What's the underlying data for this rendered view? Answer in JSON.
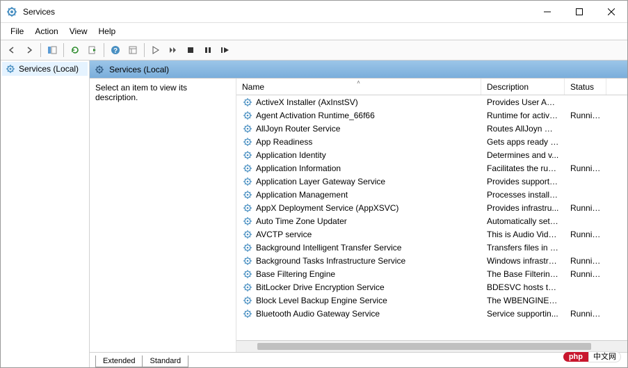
{
  "window": {
    "title": "Services"
  },
  "menubar": [
    "File",
    "Action",
    "View",
    "Help"
  ],
  "tree": {
    "root": "Services (Local)"
  },
  "pane_header": "Services (Local)",
  "desc_prompt": "Select an item to view its description.",
  "columns": {
    "name": "Name",
    "description": "Description",
    "status": "Status"
  },
  "services": [
    {
      "name": "ActiveX Installer (AxInstSV)",
      "desc": "Provides User Acc...",
      "status": ""
    },
    {
      "name": "Agent Activation Runtime_66f66",
      "desc": "Runtime for activa...",
      "status": "Running"
    },
    {
      "name": "AllJoyn Router Service",
      "desc": "Routes AllJoyn me...",
      "status": ""
    },
    {
      "name": "App Readiness",
      "desc": "Gets apps ready fo...",
      "status": ""
    },
    {
      "name": "Application Identity",
      "desc": "Determines and v...",
      "status": ""
    },
    {
      "name": "Application Information",
      "desc": "Facilitates the run...",
      "status": "Running"
    },
    {
      "name": "Application Layer Gateway Service",
      "desc": "Provides support f...",
      "status": ""
    },
    {
      "name": "Application Management",
      "desc": "Processes installat...",
      "status": ""
    },
    {
      "name": "AppX Deployment Service (AppXSVC)",
      "desc": "Provides infrastru...",
      "status": "Running"
    },
    {
      "name": "Auto Time Zone Updater",
      "desc": "Automatically sets...",
      "status": ""
    },
    {
      "name": "AVCTP service",
      "desc": "This is Audio Vide...",
      "status": "Running"
    },
    {
      "name": "Background Intelligent Transfer Service",
      "desc": "Transfers files in th...",
      "status": ""
    },
    {
      "name": "Background Tasks Infrastructure Service",
      "desc": "Windows infrastru...",
      "status": "Running"
    },
    {
      "name": "Base Filtering Engine",
      "desc": "The Base Filtering ...",
      "status": "Running"
    },
    {
      "name": "BitLocker Drive Encryption Service",
      "desc": "BDESVC hosts the ...",
      "status": ""
    },
    {
      "name": "Block Level Backup Engine Service",
      "desc": "The WBENGINE se...",
      "status": ""
    },
    {
      "name": "Bluetooth Audio Gateway Service",
      "desc": "Service supportin...",
      "status": "Running"
    }
  ],
  "tabs": {
    "extended": "Extended",
    "standard": "Standard"
  },
  "watermark": {
    "badge": "php",
    "text": "中文网"
  }
}
